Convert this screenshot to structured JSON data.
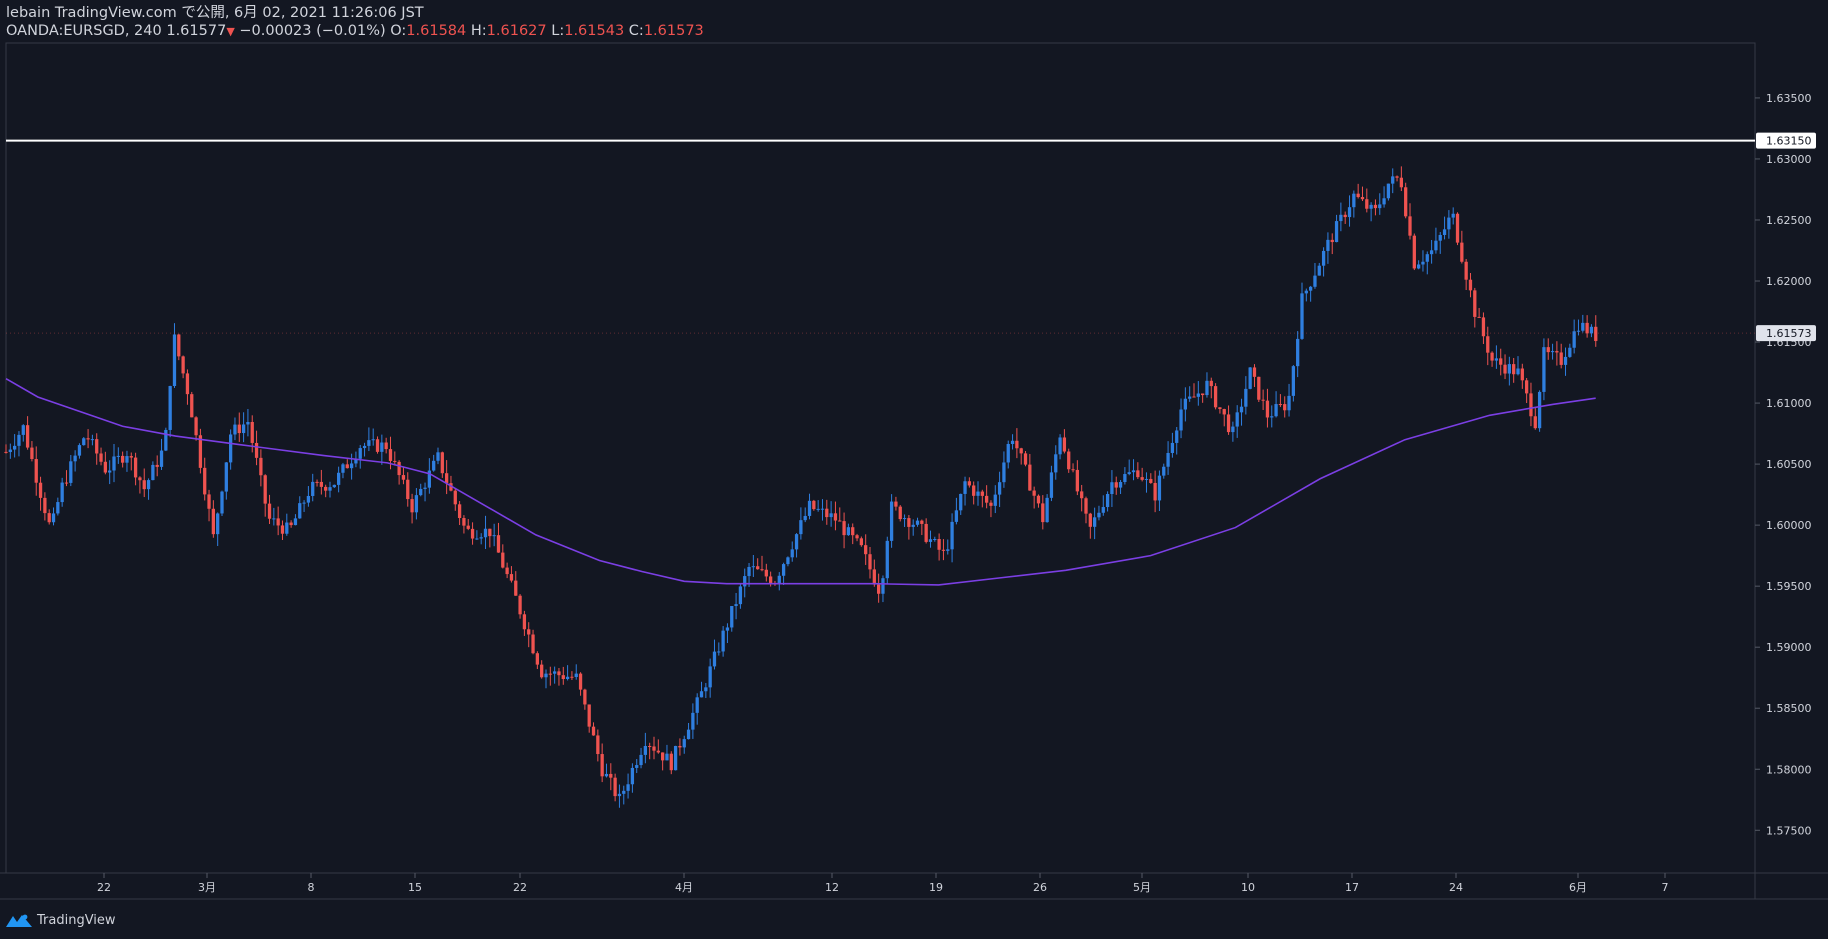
{
  "header": {
    "line1": "lebain TradingView.com で公開, 6月 02, 2021 11:26:06 JST",
    "symbol": "OANDA:EURSGD, 240",
    "last": "1.61577",
    "arrow": "▼",
    "change": "−0.00023 (−0.01%)",
    "o_label": "O:",
    "o": "1.61584",
    "h_label": "H:",
    "h": "1.61627",
    "l_label": "L:",
    "l": "1.61543",
    "c_label": "C:",
    "c": "1.61573"
  },
  "footer": {
    "brand": "TradingView"
  },
  "colors": {
    "background": "#131722",
    "up": "#2f7fe0",
    "down": "#ef5350",
    "ma": "#7b3fe4",
    "line": "#ffffff",
    "text": "#d1d4dc"
  },
  "chart_data": {
    "type": "candlestick",
    "symbol": "OANDA:EURSGD",
    "timeframe": "240",
    "y_ticks": [
      "1.57500",
      "1.58000",
      "1.58500",
      "1.59000",
      "1.59500",
      "1.60000",
      "1.60500",
      "1.61000",
      "1.61500",
      "1.62000",
      "1.62500",
      "1.63000",
      "1.63500"
    ],
    "ylim": [
      1.5715,
      1.6395
    ],
    "x_ticks": [
      "22",
      "3月",
      "8",
      "15",
      "22",
      "4月",
      "12",
      "19",
      "26",
      "5月",
      "10",
      "17",
      "24",
      "6月",
      "7"
    ],
    "horizontal_line": {
      "value": 1.6315,
      "label": "1.63150"
    },
    "last_price_label": "1.61573",
    "last_price": 1.61573,
    "price_path": [
      [
        0,
        1.606
      ],
      [
        1.0,
        1.608
      ],
      [
        2.6,
        1.5995
      ],
      [
        3.2,
        1.603
      ],
      [
        4.6,
        1.6075
      ],
      [
        5.8,
        1.6045
      ],
      [
        7.0,
        1.606
      ],
      [
        8.0,
        1.603
      ],
      [
        9.2,
        1.6065
      ],
      [
        9.7,
        1.6155
      ],
      [
        10.6,
        1.6105
      ],
      [
        12.0,
        1.599
      ],
      [
        13.0,
        1.6075
      ],
      [
        14.0,
        1.6085
      ],
      [
        15.2,
        1.6005
      ],
      [
        16.4,
        1.5995
      ],
      [
        17.6,
        1.603
      ],
      [
        19.0,
        1.6035
      ],
      [
        20.5,
        1.6065
      ],
      [
        22.0,
        1.6065
      ],
      [
        23.5,
        1.6015
      ],
      [
        25.0,
        1.6055
      ],
      [
        26.6,
        1.5995
      ],
      [
        28.0,
        1.5995
      ],
      [
        29.5,
        1.594
      ],
      [
        31.0,
        1.588
      ],
      [
        33.0,
        1.5875
      ],
      [
        34.5,
        1.58
      ],
      [
        35.5,
        1.5775
      ],
      [
        37.0,
        1.5825
      ],
      [
        38.5,
        1.5805
      ],
      [
        40.2,
        1.586
      ],
      [
        41.5,
        1.591
      ],
      [
        43.0,
        1.5965
      ],
      [
        44.5,
        1.5955
      ],
      [
        46.5,
        1.6015
      ],
      [
        48.0,
        1.6005
      ],
      [
        49.5,
        1.598
      ],
      [
        50.6,
        1.5945
      ],
      [
        51.2,
        1.6015
      ],
      [
        52.7,
        1.6
      ],
      [
        54.3,
        1.5975
      ],
      [
        55.5,
        1.6035
      ],
      [
        57.0,
        1.6015
      ],
      [
        58.2,
        1.6075
      ],
      [
        60.0,
        1.6005
      ],
      [
        61.0,
        1.6075
      ],
      [
        62.7,
        1.5995
      ],
      [
        64.0,
        1.6035
      ],
      [
        65.5,
        1.6045
      ],
      [
        66.5,
        1.6025
      ],
      [
        68.0,
        1.6095
      ],
      [
        69.5,
        1.6115
      ],
      [
        71.0,
        1.6075
      ],
      [
        72.0,
        1.6125
      ],
      [
        73.0,
        1.609
      ],
      [
        74.2,
        1.61
      ],
      [
        75.0,
        1.6185
      ],
      [
        76.5,
        1.623
      ],
      [
        78.0,
        1.627
      ],
      [
        79.2,
        1.6255
      ],
      [
        80.0,
        1.628
      ],
      [
        80.7,
        1.6285
      ],
      [
        81.5,
        1.6215
      ],
      [
        82.6,
        1.6225
      ],
      [
        83.7,
        1.6255
      ],
      [
        85.0,
        1.6175
      ],
      [
        86.0,
        1.6135
      ],
      [
        87.5,
        1.6125
      ],
      [
        88.5,
        1.6085
      ],
      [
        89.0,
        1.614
      ],
      [
        90.0,
        1.6135
      ],
      [
        91.0,
        1.6165
      ],
      [
        92.0,
        1.6155
      ]
    ],
    "moving_average": [
      [
        0,
        1.612
      ],
      [
        3,
        1.6105
      ],
      [
        8,
        1.609
      ],
      [
        11,
        1.6081
      ],
      [
        16,
        1.6073
      ],
      [
        22,
        1.6066
      ],
      [
        30,
        1.6057
      ],
      [
        36,
        1.6051
      ],
      [
        40,
        1.6042
      ],
      [
        46,
        1.6012
      ],
      [
        50,
        1.5992
      ],
      [
        56,
        1.5971
      ],
      [
        60,
        1.5962
      ],
      [
        64,
        1.5954
      ],
      [
        68,
        1.5952
      ],
      [
        74,
        1.5952
      ],
      [
        82,
        1.5952
      ],
      [
        88,
        1.5951
      ],
      [
        94,
        1.5957
      ],
      [
        100,
        1.5963
      ],
      [
        108,
        1.5975
      ],
      [
        116,
        1.5998
      ],
      [
        124,
        1.6038
      ],
      [
        132,
        1.607
      ],
      [
        140,
        1.609
      ],
      [
        146,
        1.6099
      ],
      [
        150,
        1.6104
      ]
    ]
  }
}
